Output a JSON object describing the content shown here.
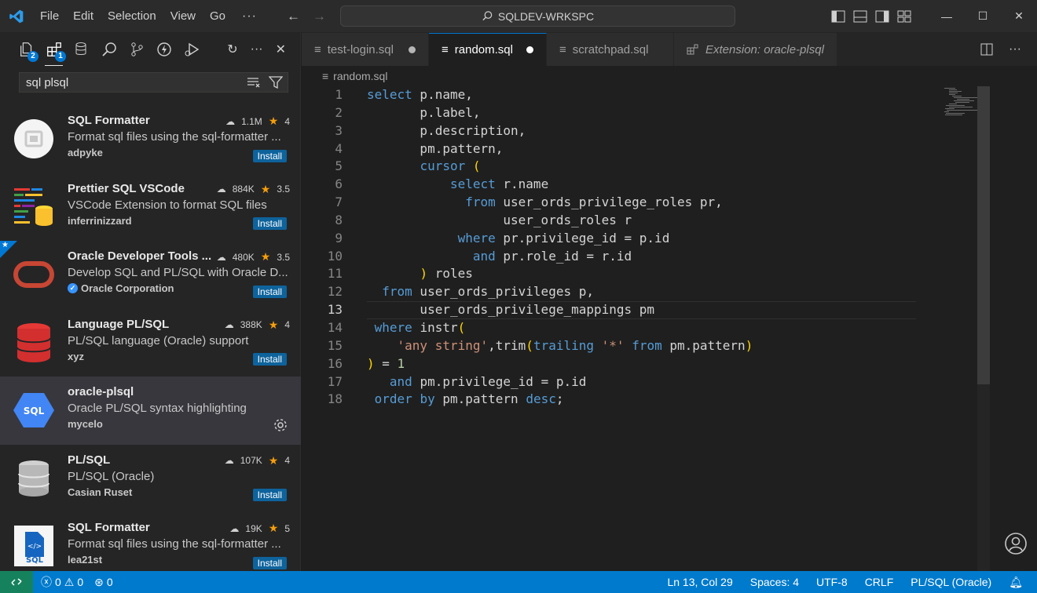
{
  "menu": [
    "File",
    "Edit",
    "Selection",
    "View",
    "Go"
  ],
  "menu_more": "···",
  "command_center": "SQLDEV-WRKSPC",
  "sidebar": {
    "search_value": "sql plsql",
    "badges": {
      "explorer": "2",
      "extensions": "1"
    },
    "extensions": [
      {
        "name": "SQL Formatter",
        "downloads": "1.1M",
        "rating": "4",
        "description": "Format sql files using the sql-formatter ...",
        "author": "adpyke",
        "action": "Install"
      },
      {
        "name": "Prettier SQL VSCode",
        "downloads": "884K",
        "rating": "3.5",
        "description": "VSCode Extension to format SQL files",
        "author": "inferrinizzard",
        "action": "Install"
      },
      {
        "name": "Oracle Developer Tools ...",
        "downloads": "480K",
        "rating": "3.5",
        "description": "Develop SQL and PL/SQL with Oracle D...",
        "author": "Oracle Corporation",
        "action": "Install"
      },
      {
        "name": "Language PL/SQL",
        "downloads": "388K",
        "rating": "4",
        "description": "PL/SQL language (Oracle) support",
        "author": "xyz",
        "action": "Install"
      },
      {
        "name": "oracle-plsql",
        "downloads": "",
        "rating": "",
        "description": "Oracle PL/SQL syntax highlighting",
        "author": "mycelo",
        "action": ""
      },
      {
        "name": "PL/SQL",
        "downloads": "107K",
        "rating": "4",
        "description": "PL/SQL (Oracle)",
        "author": "Casian Ruset",
        "action": "Install"
      },
      {
        "name": "SQL Formatter",
        "downloads": "19K",
        "rating": "5",
        "description": "Format sql files using the sql-formatter ...",
        "author": "lea21st",
        "action": "Install"
      }
    ]
  },
  "tabs": [
    {
      "label": "test-login.sql",
      "dirty": true
    },
    {
      "label": "random.sql",
      "dirty": true,
      "active": true
    },
    {
      "label": "scratchpad.sql",
      "dirty": false
    },
    {
      "label": "Extension: oracle-plsql",
      "dirty": false
    }
  ],
  "breadcrumb": "random.sql",
  "code_lines": [
    "select p.name,",
    "       p.label,",
    "       p.description,",
    "       pm.pattern,",
    "       cursor (",
    "           select r.name",
    "             from user_ords_privilege_roles pr,",
    "                  user_ords_roles r",
    "            where pr.privilege_id = p.id",
    "              and pr.role_id = r.id",
    "       ) roles",
    "  from user_ords_privileges p,",
    "       user_ords_privilege_mappings pm",
    " where instr(",
    "    'any string',trim(trailing '*' from pm.pattern)",
    ") = 1",
    "   and pm.privilege_id = p.id",
    " order by pm.pattern desc;"
  ],
  "current_line": 13,
  "status": {
    "errors": "0",
    "warnings": "0",
    "ports": "0",
    "position": "Ln 13, Col 29",
    "spaces": "Spaces: 4",
    "encoding": "UTF-8",
    "eol": "CRLF",
    "language": "PL/SQL (Oracle)"
  },
  "colors": {
    "accent": "#0078d4",
    "statusbar": "#007acc",
    "keyword": "#569cd6",
    "string": "#ce9178",
    "number": "#b5cea8",
    "bracket": "#ffd700"
  }
}
